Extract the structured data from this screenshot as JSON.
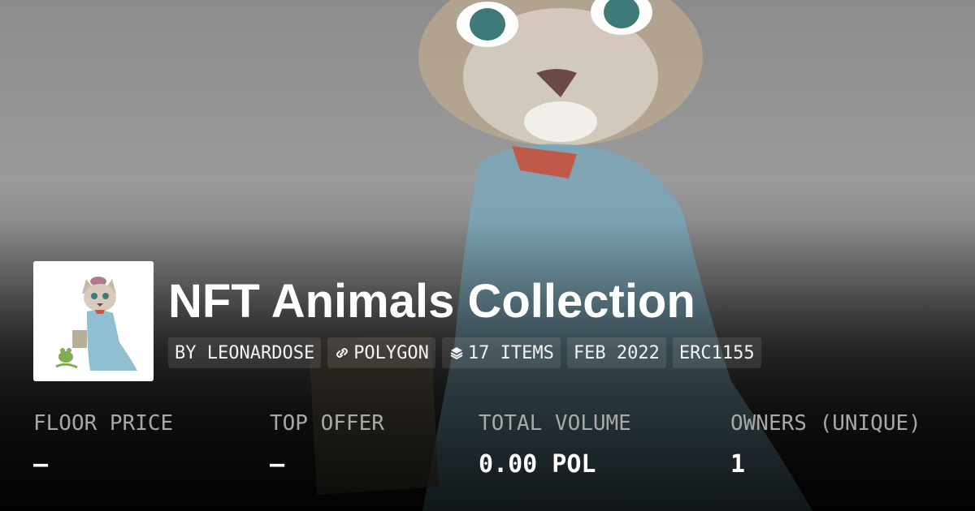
{
  "collection": {
    "title": "NFT Animals Collection"
  },
  "tags": [
    {
      "label": "BY LEONARDOSE",
      "icon": ""
    },
    {
      "label": "POLYGON",
      "icon": "polygon-link-icon"
    },
    {
      "label": "17 ITEMS",
      "icon": "layers-icon"
    },
    {
      "label": "FEB 2022",
      "icon": ""
    },
    {
      "label": "ERC1155",
      "icon": ""
    }
  ],
  "stats": [
    {
      "label": "FLOOR PRICE",
      "value": "—"
    },
    {
      "label": "TOP OFFER",
      "value": "—"
    },
    {
      "label": "TOTAL VOLUME",
      "value": "0.00 POL"
    },
    {
      "label": "OWNERS (UNIQUE)",
      "value": "1"
    }
  ],
  "colors": {
    "title": "#ffffff",
    "label": "#a8a8a8",
    "tag_bg": "rgba(255,255,255,0.10)"
  }
}
